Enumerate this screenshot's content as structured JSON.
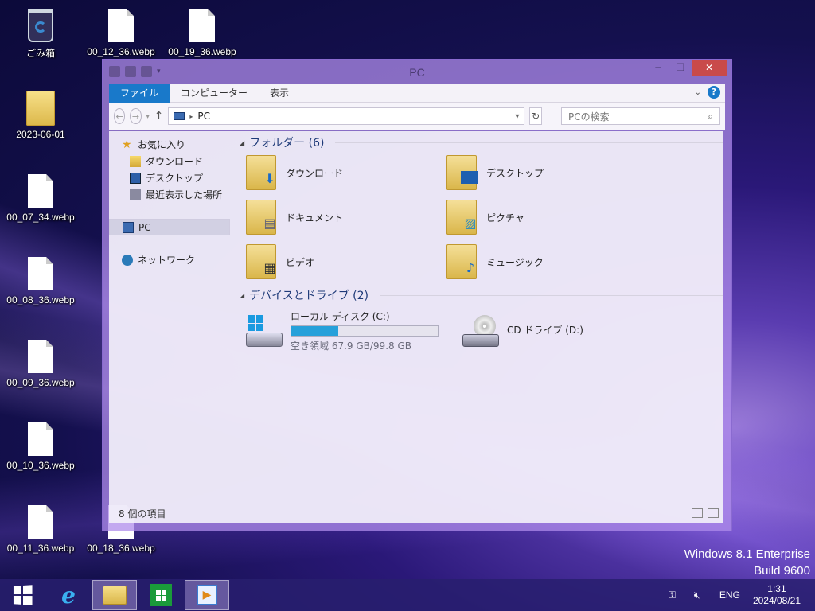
{
  "desktop": {
    "icons": [
      {
        "label": "ごみ箱"
      },
      {
        "label": "00_12_36.webp"
      },
      {
        "label": "00_19_36.webp"
      },
      {
        "label": "2023-06-01"
      },
      {
        "label": "00_07_34.webp"
      },
      {
        "label": "00_08_36.webp"
      },
      {
        "label": "00_09_36.webp"
      },
      {
        "label": "00_10_36.webp"
      },
      {
        "label": "00_11_36.webp"
      },
      {
        "label": "00_18_36.webp"
      }
    ],
    "watermark": {
      "line1": "Windows 8.1 Enterprise",
      "line2": "Build 9600"
    }
  },
  "window": {
    "title": "PC",
    "ribbon_tabs": [
      "ファイル",
      "コンピューター",
      "表示"
    ],
    "address": {
      "path": "PC"
    },
    "search": {
      "placeholder": "PCの検索"
    },
    "nav": {
      "favorites": "お気に入り",
      "items": [
        "ダウンロード",
        "デスクトップ",
        "最近表示した場所"
      ],
      "pc": "PC",
      "network": "ネットワーク"
    },
    "folders_group": "フォルダー (6)",
    "folders": [
      {
        "name": "ダウンロード",
        "icon": "download-arrow"
      },
      {
        "name": "デスクトップ",
        "icon": "desktop-monitor"
      },
      {
        "name": "ドキュメント",
        "icon": "document"
      },
      {
        "name": "ピクチャ",
        "icon": "picture"
      },
      {
        "name": "ビデオ",
        "icon": "film"
      },
      {
        "name": "ミュージック",
        "icon": "music-note"
      }
    ],
    "drives_group": "デバイスとドライブ (2)",
    "drives": [
      {
        "name": "ローカル ディスク (C:)",
        "free_text": "空き領域 67.9 GB/99.8 GB",
        "used_fraction": 0.32
      },
      {
        "name": "CD ドライブ (D:)"
      }
    ],
    "status": "8 個の項目"
  },
  "taskbar": {
    "lang": "ENG",
    "time": "1:31",
    "date": "2024/08/21"
  },
  "colors": {
    "accent": "#1979ca",
    "drive_bar": "#26a0da",
    "close": "#c94a4a"
  }
}
